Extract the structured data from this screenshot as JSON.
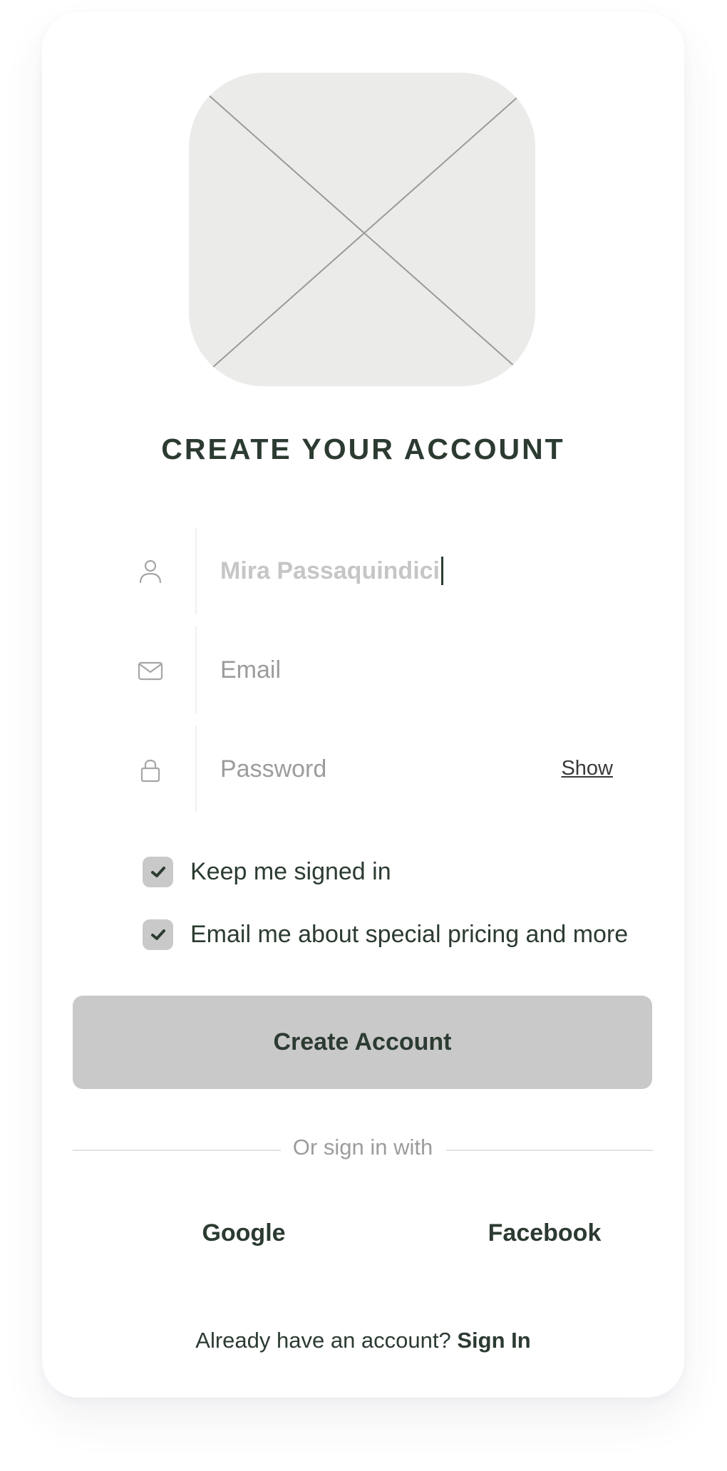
{
  "title": "CREATE YOUR ACCOUNT",
  "logo": {
    "icon": "image-placeholder-icon"
  },
  "fields": {
    "name": {
      "value": "Mira Passaquindici",
      "icon": "user-icon"
    },
    "email": {
      "placeholder": "Email",
      "icon": "mail-icon"
    },
    "password": {
      "placeholder": "Password",
      "icon": "lock-icon",
      "toggle_label": "Show"
    }
  },
  "options": {
    "keep_signed_in": {
      "label": "Keep me signed in",
      "checked": true
    },
    "email_pricing": {
      "label": "Email me about special pricing and more",
      "checked": true
    }
  },
  "primary_button": "Create Account",
  "divider_text": "Or sign in with",
  "social": {
    "google": "Google",
    "facebook": "Facebook"
  },
  "footer": {
    "prompt": "Already have an account?",
    "link": "Sign In"
  },
  "colors": {
    "text_dark": "#2c3b31",
    "muted": "#9c9c9c",
    "button_bg": "#c9c9c9",
    "placeholder_bg": "#ebebea"
  }
}
